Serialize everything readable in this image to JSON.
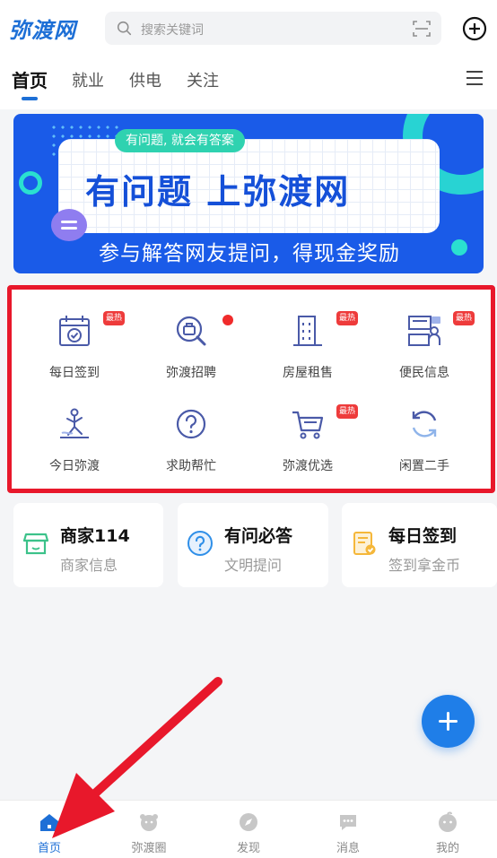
{
  "app": {
    "logo_text": "弥渡网"
  },
  "search": {
    "placeholder": "搜索关键词"
  },
  "tabs": [
    {
      "label": "首页",
      "active": true
    },
    {
      "label": "就业"
    },
    {
      "label": "供电"
    },
    {
      "label": "关注"
    }
  ],
  "banner": {
    "pill": "有问题, 就会有答案",
    "headline": "有问题 上弥渡网",
    "subline": "参与解答网友提问，得现金奖励"
  },
  "grid": [
    {
      "label": "每日签到",
      "icon": "calendar-check-icon",
      "badge": "最热"
    },
    {
      "label": "弥渡招聘",
      "icon": "search-briefcase-icon",
      "dot": true
    },
    {
      "label": "房屋租售",
      "icon": "building-icon",
      "badge": "最热"
    },
    {
      "label": "便民信息",
      "icon": "service-desk-icon",
      "badge": "最热"
    },
    {
      "label": "今日弥渡",
      "icon": "dancer-icon"
    },
    {
      "label": "求助帮忙",
      "icon": "question-circle-icon"
    },
    {
      "label": "弥渡优选",
      "icon": "shopping-cart-icon",
      "badge": "最热"
    },
    {
      "label": "闲置二手",
      "icon": "recycle-icon"
    }
  ],
  "cards": [
    {
      "title": "商家114",
      "subtitle": "商家信息",
      "icon": "shop-icon",
      "color": "#3cc28a"
    },
    {
      "title": "有问必答",
      "subtitle": "文明提问",
      "icon": "question-icon",
      "color": "#2f8fe8"
    },
    {
      "title": "每日签到",
      "subtitle": "签到拿金币",
      "icon": "checkin-icon",
      "color": "#f5b73a"
    }
  ],
  "bottom_nav": [
    {
      "label": "首页",
      "icon": "home-icon",
      "active": true
    },
    {
      "label": "弥渡圈",
      "icon": "community-icon"
    },
    {
      "label": "发现",
      "icon": "discover-icon"
    },
    {
      "label": "消息",
      "icon": "message-icon"
    },
    {
      "label": "我的",
      "icon": "profile-icon"
    }
  ],
  "colors": {
    "brand": "#1d6fd6",
    "highlight_box": "#e8182b",
    "badge": "#ee3b3b",
    "annotation_arrow": "#e8182b"
  }
}
